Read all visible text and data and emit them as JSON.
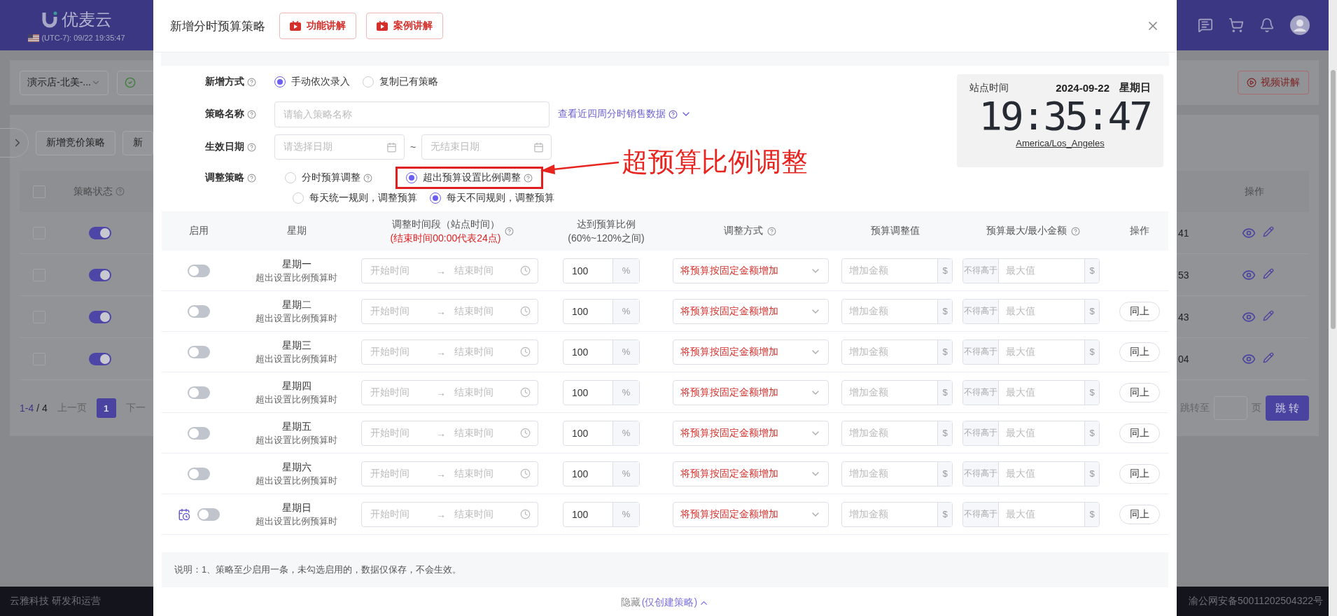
{
  "background": {
    "logo": "优麦云",
    "site_clock": "(UTC-7): 09/22 19:35:47",
    "shop": "演示店-北美-...",
    "toolbar": [
      "新增竞价策略",
      "新"
    ],
    "all_checked": false,
    "status_header": "策略状态",
    "action_header": "操作",
    "video_button": "视频讲解",
    "rows": [
      {
        "checked": false,
        "on": true,
        "tail": "41"
      },
      {
        "checked": false,
        "on": true,
        "tail": "53"
      },
      {
        "checked": false,
        "on": true,
        "tail": "43"
      },
      {
        "checked": false,
        "on": true,
        "tail": "04"
      }
    ],
    "pagination": {
      "range": "1-4",
      "total": "/ 4",
      "prev": "上一页",
      "pages": [
        {
          "label": "1",
          "selected": true
        }
      ],
      "next": "下一",
      "jump_label": "跳转至",
      "unit": "页",
      "jump_button": "跳 转"
    },
    "footer_left": "云雅科技 研发和运营",
    "footer_right": "渝公网安备50011202504322号"
  },
  "modal": {
    "title": "新增分时预算策略",
    "header_buttons": [
      "功能讲解",
      "案例讲解"
    ],
    "form": {
      "add_method": {
        "label": "新增方式",
        "options": [
          {
            "label": "手动依次录入",
            "selected": true
          },
          {
            "label": "复制已有策略",
            "selected": false
          }
        ]
      },
      "name": {
        "label": "策略名称",
        "placeholder": "请输入策略名称",
        "link": "查看近四周分时销售数据"
      },
      "date": {
        "label": "生效日期",
        "start": {
          "placeholder": "请选择日期"
        },
        "separator": "~",
        "end": {
          "placeholder": "无结束日期"
        }
      },
      "strategy": {
        "label": "调整策略",
        "options": [
          {
            "label": "分时预算调整",
            "selected": false,
            "highlighted": false
          },
          {
            "label": "超出预算设置比例调整",
            "selected": true,
            "highlighted": true
          }
        ],
        "sub_options": [
          {
            "label": "每天统一规则，调整预算",
            "selected": false
          },
          {
            "label": "每天不同规则，调整预算",
            "selected": true
          }
        ]
      }
    },
    "annotation": "超预算比例调整",
    "clock": {
      "label": "站点时间",
      "date": "2024-09-22",
      "weekday": "星期日",
      "time": "19:35:47",
      "timezone": "America/Los_Angeles"
    },
    "table": {
      "columns": [
        {
          "title": "启用"
        },
        {
          "title": "星期"
        },
        {
          "title": "调整时间段（站点时间）",
          "note": "(结束时间00:00代表24点)",
          "help": true
        },
        {
          "title": "达到预算比例",
          "note": "(60%~120%之间)"
        },
        {
          "title": "调整方式",
          "help": true
        },
        {
          "title": "预算调整值"
        },
        {
          "title": "预算最大/最小金额",
          "help": true
        },
        {
          "title": "操作"
        }
      ],
      "rows": [
        {
          "day": "星期一",
          "sub": "超出设置比例预算时",
          "enabled": false,
          "start": {
            "placeholder": "开始时间"
          },
          "arrow": "→",
          "end": {
            "placeholder": "结束时间"
          },
          "ratio": "100",
          "unit": "%",
          "mode": "将预算按固定金额增加",
          "amount": {
            "placeholder": "增加金额"
          },
          "currency": "$",
          "limit_prefix": "不得高于",
          "limit": {
            "placeholder": "最大值"
          },
          "limit_currency": "$"
        },
        {
          "day": "星期二",
          "sub": "超出设置比例预算时",
          "enabled": false,
          "start": {
            "placeholder": "开始时间"
          },
          "arrow": "→",
          "end": {
            "placeholder": "结束时间"
          },
          "ratio": "100",
          "unit": "%",
          "mode": "将预算按固定金额增加",
          "amount": {
            "placeholder": "增加金额"
          },
          "currency": "$",
          "limit_prefix": "不得高于",
          "limit": {
            "placeholder": "最大值"
          },
          "limit_currency": "$",
          "action": "同上"
        },
        {
          "day": "星期三",
          "sub": "超出设置比例预算时",
          "enabled": false,
          "start": {
            "placeholder": "开始时间"
          },
          "arrow": "→",
          "end": {
            "placeholder": "结束时间"
          },
          "ratio": "100",
          "unit": "%",
          "mode": "将预算按固定金额增加",
          "amount": {
            "placeholder": "增加金额"
          },
          "currency": "$",
          "limit_prefix": "不得高于",
          "limit": {
            "placeholder": "最大值"
          },
          "limit_currency": "$",
          "action": "同上"
        },
        {
          "day": "星期四",
          "sub": "超出设置比例预算时",
          "enabled": false,
          "start": {
            "placeholder": "开始时间"
          },
          "arrow": "→",
          "end": {
            "placeholder": "结束时间"
          },
          "ratio": "100",
          "unit": "%",
          "mode": "将预算按固定金额增加",
          "amount": {
            "placeholder": "增加金额"
          },
          "currency": "$",
          "limit_prefix": "不得高于",
          "limit": {
            "placeholder": "最大值"
          },
          "limit_currency": "$",
          "action": "同上"
        },
        {
          "day": "星期五",
          "sub": "超出设置比例预算时",
          "enabled": false,
          "start": {
            "placeholder": "开始时间"
          },
          "arrow": "→",
          "end": {
            "placeholder": "结束时间"
          },
          "ratio": "100",
          "unit": "%",
          "mode": "将预算按固定金额增加",
          "amount": {
            "placeholder": "增加金额"
          },
          "currency": "$",
          "limit_prefix": "不得高于",
          "limit": {
            "placeholder": "最大值"
          },
          "limit_currency": "$",
          "action": "同上"
        },
        {
          "day": "星期六",
          "sub": "超出设置比例预算时",
          "enabled": false,
          "start": {
            "placeholder": "开始时间"
          },
          "arrow": "→",
          "end": {
            "placeholder": "结束时间"
          },
          "ratio": "100",
          "unit": "%",
          "mode": "将预算按固定金额增加",
          "amount": {
            "placeholder": "增加金额"
          },
          "currency": "$",
          "limit_prefix": "不得高于",
          "limit": {
            "placeholder": "最大值"
          },
          "limit_currency": "$",
          "action": "同上"
        },
        {
          "day": "星期日",
          "sub": "超出设置比例预算时",
          "enabled": false,
          "calendar": true,
          "start": {
            "placeholder": "开始时间"
          },
          "arrow": "→",
          "end": {
            "placeholder": "结束时间"
          },
          "ratio": "100",
          "unit": "%",
          "mode": "将预算按固定金额增加",
          "amount": {
            "placeholder": "增加金额"
          },
          "currency": "$",
          "limit_prefix": "不得高于",
          "limit": {
            "placeholder": "最大值"
          },
          "limit_currency": "$",
          "action": "同上"
        }
      ]
    },
    "note": "说明：1、策略至少启用一条，未勾选启用的，数据仅保存，不会生效。",
    "collapse": {
      "label": "隐藏",
      "hint": "(仅创建策略)"
    }
  }
}
